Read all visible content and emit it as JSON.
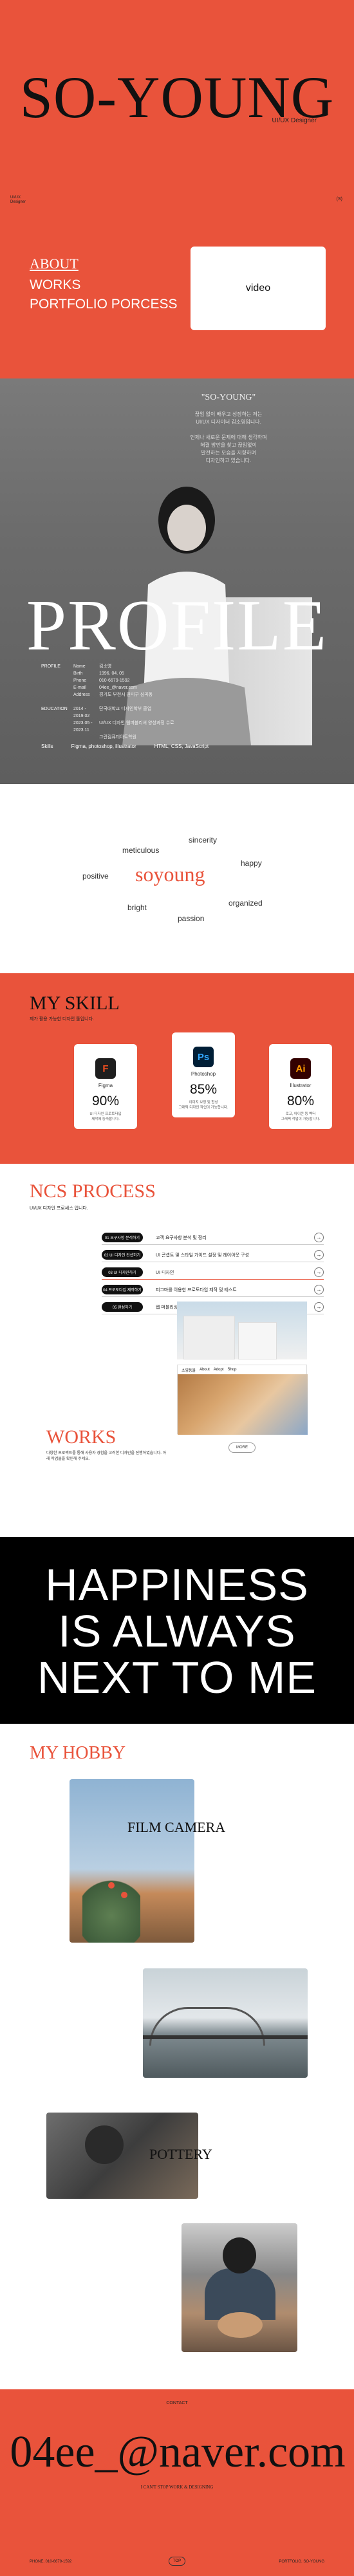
{
  "hero": {
    "logo": "SO-YOUNG",
    "subtitle": "UI/UX Designer",
    "tiny_left": "UI/UX\nDesigner",
    "tiny_right": "(S)",
    "nav": {
      "about": "ABOUT",
      "works": "WORKS",
      "process": "PORTFOLIO PORCESS"
    },
    "video_label": "video"
  },
  "profile": {
    "quote": "\"SO-YOUNG\"",
    "quote_lines": [
      "끊임 없이 배우고 성장하는 저는",
      "UI/UX 디자이너 김소영입니다.",
      "",
      "언제나 새로운 문제에 대해 생각하며",
      "해결 방안을 찾고 끊임없이",
      "발전하는 모습을 지향하며",
      "디자인하고 있습니다."
    ],
    "big": "PROFILE",
    "info_rows": [
      {
        "k": "PROFILE",
        "k2": "Name",
        "v": "김소영"
      },
      {
        "k": "",
        "k2": "Birth",
        "v": "1996. 04. 05"
      },
      {
        "k": "",
        "k2": "Phone",
        "v": "010-6679-1592"
      },
      {
        "k": "",
        "k2": "E-mail",
        "v": "04ee_@naver.com"
      },
      {
        "k": "",
        "k2": "Address",
        "v": "경기도 부천시 원미구 심곡동"
      },
      {
        "k": "",
        "k2": "",
        "v": ""
      },
      {
        "k": "EDUCATION",
        "k2": "2014 - 2019.02",
        "v": "단국대학교 디자인학부 졸업"
      },
      {
        "k": "",
        "k2": "2023.05 - 2023.11",
        "v": "UI/UX 디자인 웹퍼블리셔 양성과정 수료"
      },
      {
        "k": "",
        "k2": "",
        "v": "그린컴퓨터아트학원"
      }
    ],
    "skills_label": "Skills",
    "skills": [
      "Figma, photoshop, illustrator",
      "HTML, CSS, JavaScript"
    ]
  },
  "keywords": {
    "main": "soyoung",
    "words": [
      "sincerity",
      "meticulous",
      "happy",
      "positive",
      "bright",
      "organized",
      "passion"
    ]
  },
  "skill": {
    "title": "MY SKILL",
    "desc": "제가 활용 가능한 디자인 툴입니다.",
    "cards": [
      {
        "name": "Figma",
        "percent": "90%",
        "desc": "UI 디자인 프로토타입\n제작에 능숙합니다.",
        "icon": "figma-icon",
        "icon_glyph": "F",
        "icon_bg": "#1e1e1e",
        "icon_fg": "#f24e1e"
      },
      {
        "name": "Photoshop",
        "percent": "85%",
        "desc": "이미지 보정 및 합성\n그래픽 디자인 작업이 가능합니다.",
        "icon": "photoshop-icon",
        "icon_glyph": "Ps",
        "icon_bg": "#001e36",
        "icon_fg": "#31a8ff"
      },
      {
        "name": "Illustrator",
        "percent": "80%",
        "desc": "로고, 아이콘 등 벡터\n그래픽 작업이 가능합니다.",
        "icon": "illustrator-icon",
        "icon_glyph": "Ai",
        "icon_bg": "#330000",
        "icon_fg": "#ff9a00"
      }
    ]
  },
  "ncs": {
    "title": "NCS PROCESS",
    "desc": "UI/UX 디자인 프로세스 입니다.",
    "rows": [
      {
        "pill": "01 요구사항 분석하기",
        "text": "고객 요구사항 분석 및 정리"
      },
      {
        "pill": "02 UI 디자인 컨셉하기",
        "text": "UI 콘셉트 및 스타일 가이드 설정 및 레이아웃 구성"
      },
      {
        "pill": "03 UI 디자인하기",
        "text": "UI 디자인"
      },
      {
        "pill": "04 프로토타입 제작하기",
        "text": "피그마를 이용한 프로토타입 제작 및 테스트"
      },
      {
        "pill": "05 완성하기",
        "text": "웹 퍼블리싱으로 구현, 반응형 웹 디자인 적용 및 완성"
      }
    ],
    "works_title": "WORKS",
    "works_desc": "다양한 프로젝트를 통해 사용자 경험을 고려한 디자인을 진행하였습니다. 아래 작업물을 확인해 주세요.",
    "web_tab": "소영동물",
    "web_menu": [
      "About",
      "Adopt",
      "Shop"
    ],
    "more": "MORE"
  },
  "happy": {
    "lines": [
      "HAPPINESS",
      "IS ALWAYS",
      "NEXT TO ME"
    ]
  },
  "hobby": {
    "title": "MY HOBBY",
    "film": "FILM CAMERA",
    "pottery": "POTTERY"
  },
  "footer": {
    "contact": "CONTACT",
    "email": "04ee_@naver.com",
    "tag": "I CAN'T STOP WORK & DESIGNING",
    "left": "PHONE. 010-6679-1592",
    "right": "PORTFOLIO. SO-YOUNG",
    "up": "TOP"
  },
  "colors": {
    "accent": "#e9533b",
    "dark": "#000000",
    "white": "#ffffff"
  }
}
